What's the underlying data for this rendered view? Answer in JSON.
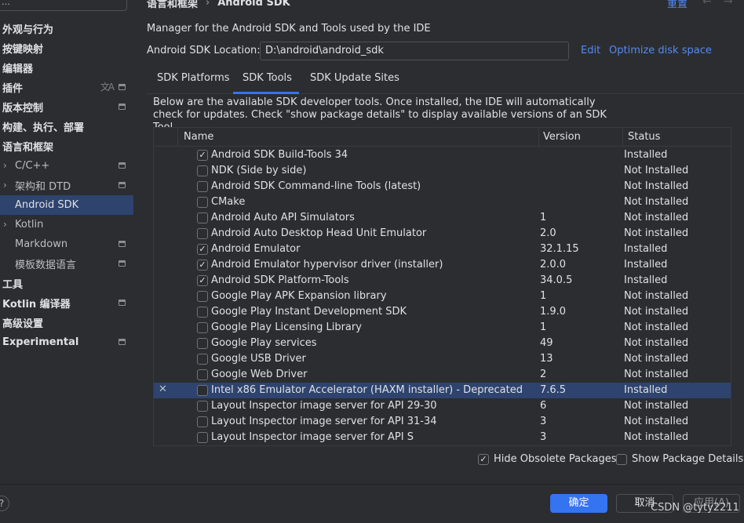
{
  "sidebar": {
    "search_glyph": "…",
    "items": [
      {
        "label": "外观与行为",
        "bold": true
      },
      {
        "label": "按键映射",
        "bold": true
      },
      {
        "label": "编辑器",
        "bold": true
      },
      {
        "label": "插件",
        "bold": true
      },
      {
        "label": "版本控制",
        "bold": true
      },
      {
        "label": "构建、执行、部署",
        "bold": true
      },
      {
        "label": "语言和框架",
        "bold": true
      },
      {
        "label": "C/C++",
        "bold": false
      },
      {
        "label": "架构和 DTD",
        "bold": false
      },
      {
        "label": "Android SDK",
        "bold": false
      },
      {
        "label": "Kotlin",
        "bold": false
      },
      {
        "label": "Markdown",
        "bold": false
      },
      {
        "label": "模板数据语言",
        "bold": false
      },
      {
        "label": "工具",
        "bold": true
      },
      {
        "label": "Kotlin 编译器",
        "bold": true
      },
      {
        "label": "高级设置",
        "bold": true
      },
      {
        "label": "Experimental",
        "bold": true
      }
    ],
    "selected": "Android SDK",
    "translate_icon_glyph": "文A"
  },
  "header": {
    "breadcrumb": [
      "语言和框架",
      "Android SDK"
    ],
    "breadcrumb_separator": "›",
    "reset_label": "重置",
    "back_glyph": "←",
    "forward_glyph": "→"
  },
  "description": "Manager for the Android SDK and Tools used by the IDE",
  "location": {
    "label": "Android SDK Location:",
    "value": "D:\\android\\android_sdk",
    "edit_label": "Edit",
    "optimize_label": "Optimize disk space"
  },
  "tabs": [
    {
      "label": "SDK Platforms",
      "active": false
    },
    {
      "label": "SDK Tools",
      "active": true
    },
    {
      "label": "SDK Update Sites",
      "active": false
    }
  ],
  "intro": "Below are the available SDK developer tools. Once installed, the IDE will automatically check for updates. Check \"show package details\" to display available versions of an SDK Tool.",
  "table": {
    "columns": [
      "Name",
      "Version",
      "Status"
    ],
    "rows": [
      {
        "name": "Android SDK Build-Tools 34",
        "version": "",
        "status": "Installed",
        "checked": true,
        "selected": false
      },
      {
        "name": "NDK (Side by side)",
        "version": "",
        "status": "Not Installed",
        "checked": false,
        "selected": false
      },
      {
        "name": "Android SDK Command-line Tools (latest)",
        "version": "",
        "status": "Not Installed",
        "checked": false,
        "selected": false
      },
      {
        "name": "CMake",
        "version": "",
        "status": "Not Installed",
        "checked": false,
        "selected": false
      },
      {
        "name": "Android Auto API Simulators",
        "version": "1",
        "status": "Not installed",
        "checked": false,
        "selected": false
      },
      {
        "name": "Android Auto Desktop Head Unit Emulator",
        "version": "2.0",
        "status": "Not installed",
        "checked": false,
        "selected": false
      },
      {
        "name": "Android Emulator",
        "version": "32.1.15",
        "status": "Installed",
        "checked": true,
        "selected": false
      },
      {
        "name": "Android Emulator hypervisor driver (installer)",
        "version": "2.0.0",
        "status": "Installed",
        "checked": true,
        "selected": false
      },
      {
        "name": "Android SDK Platform-Tools",
        "version": "34.0.5",
        "status": "Installed",
        "checked": true,
        "selected": false
      },
      {
        "name": "Google Play APK Expansion library",
        "version": "1",
        "status": "Not installed",
        "checked": false,
        "selected": false
      },
      {
        "name": "Google Play Instant Development SDK",
        "version": "1.9.0",
        "status": "Not installed",
        "checked": false,
        "selected": false
      },
      {
        "name": "Google Play Licensing Library",
        "version": "1",
        "status": "Not installed",
        "checked": false,
        "selected": false
      },
      {
        "name": "Google Play services",
        "version": "49",
        "status": "Not installed",
        "checked": false,
        "selected": false
      },
      {
        "name": "Google USB Driver",
        "version": "13",
        "status": "Not installed",
        "checked": false,
        "selected": false
      },
      {
        "name": "Google Web Driver",
        "version": "2",
        "status": "Not installed",
        "checked": false,
        "selected": false
      },
      {
        "name": "Intel x86 Emulator Accelerator (HAXM installer) - Deprecated",
        "version": "7.6.5",
        "status": "Installed",
        "checked": false,
        "selected": true,
        "mark": "✕"
      },
      {
        "name": "Layout Inspector image server for API 29-30",
        "version": "6",
        "status": "Not installed",
        "checked": false,
        "selected": false
      },
      {
        "name": "Layout Inspector image server for API 31-34",
        "version": "3",
        "status": "Not installed",
        "checked": false,
        "selected": false
      },
      {
        "name": "Layout Inspector image server for API S",
        "version": "3",
        "status": "Not installed",
        "checked": false,
        "selected": false
      }
    ]
  },
  "options": {
    "hide_obsolete_label": "Hide Obsolete Packages",
    "hide_obsolete_checked": true,
    "show_details_label": "Show Package Details",
    "show_details_checked": false
  },
  "footer": {
    "help_glyph": "?",
    "ok_label": "确定",
    "cancel_label": "取消",
    "apply_label": "应用(A)",
    "watermark": "CSDN @tyty2211"
  },
  "colors": {
    "background": "#2b2d30",
    "selection": "#2e436e",
    "accent": "#3574f0",
    "link": "#548af7",
    "text": "#dfe1e5"
  }
}
